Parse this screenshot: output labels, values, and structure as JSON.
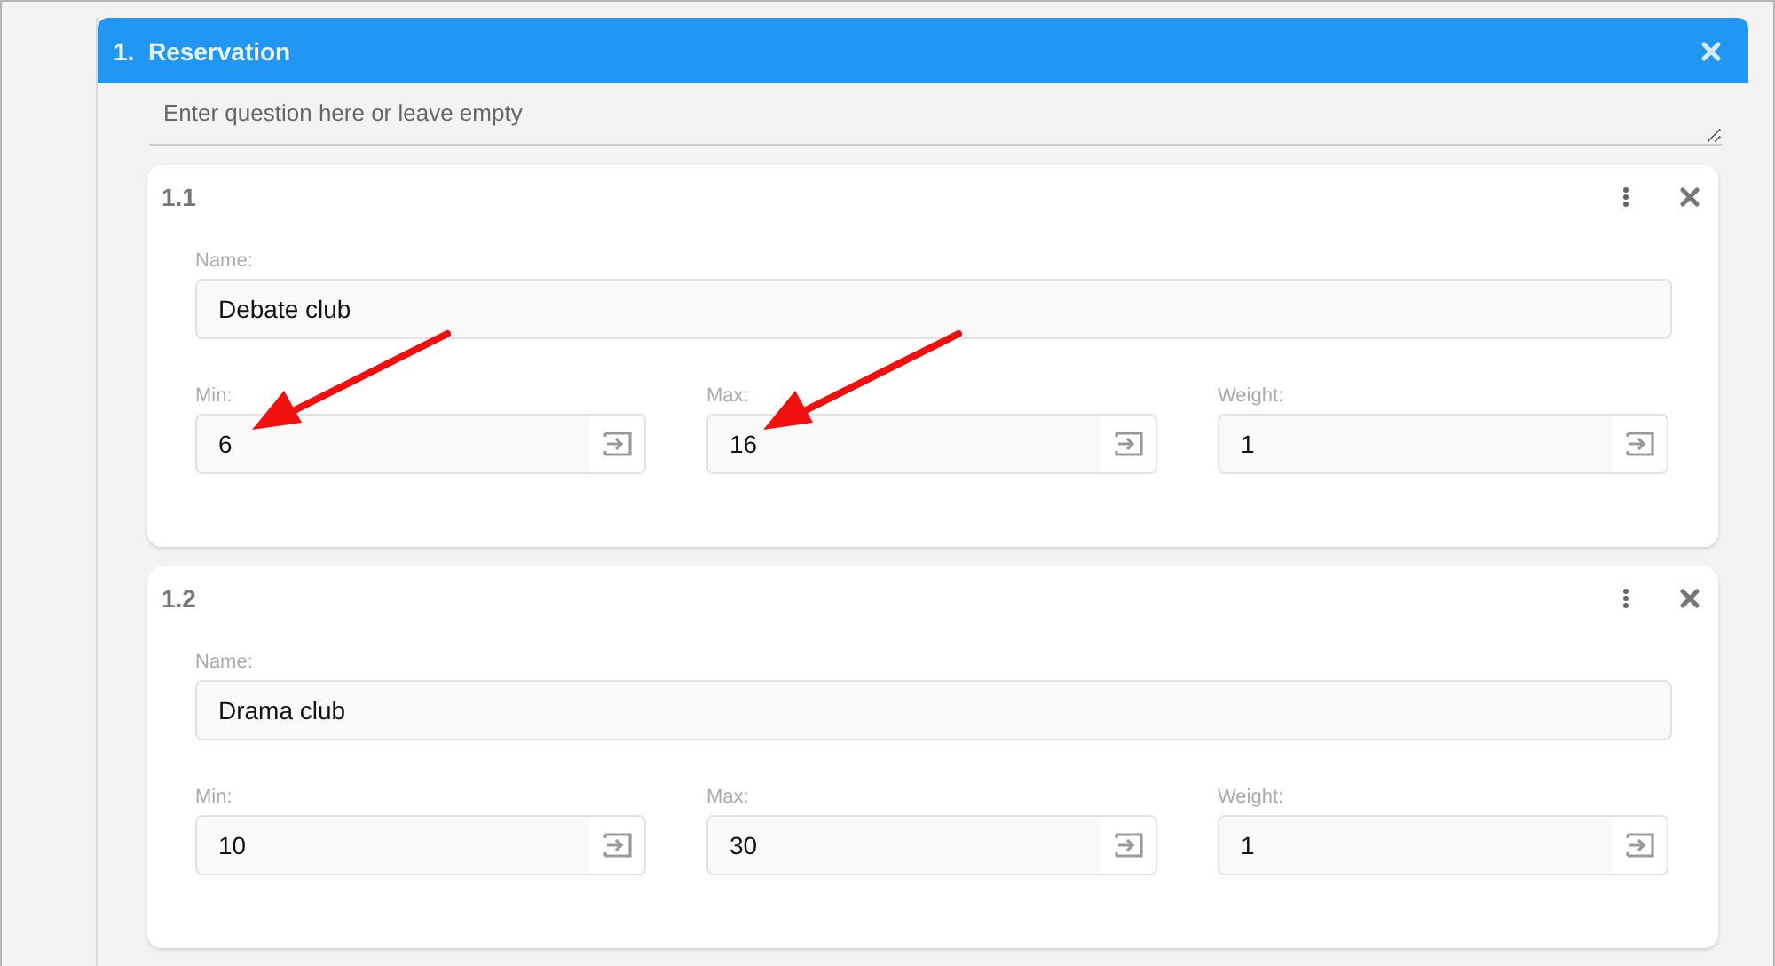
{
  "section": {
    "number": "1.",
    "title": "Reservation",
    "question": {
      "placeholder": "Enter question here or leave empty"
    }
  },
  "items": [
    {
      "number": "1.1",
      "name_label": "Name:",
      "name": "Debate club",
      "fields": [
        {
          "label": "Min:",
          "value": "6",
          "arrow": true
        },
        {
          "label": "Max:",
          "value": "16",
          "arrow": true
        },
        {
          "label": "Weight:",
          "value": "1",
          "arrow": false
        }
      ]
    },
    {
      "number": "1.2",
      "name_label": "Name:",
      "name": "Drama club",
      "fields": [
        {
          "label": "Min:",
          "value": "10",
          "arrow": false
        },
        {
          "label": "Max:",
          "value": "30",
          "arrow": false
        },
        {
          "label": "Weight:",
          "value": "1",
          "arrow": false
        }
      ]
    }
  ]
}
